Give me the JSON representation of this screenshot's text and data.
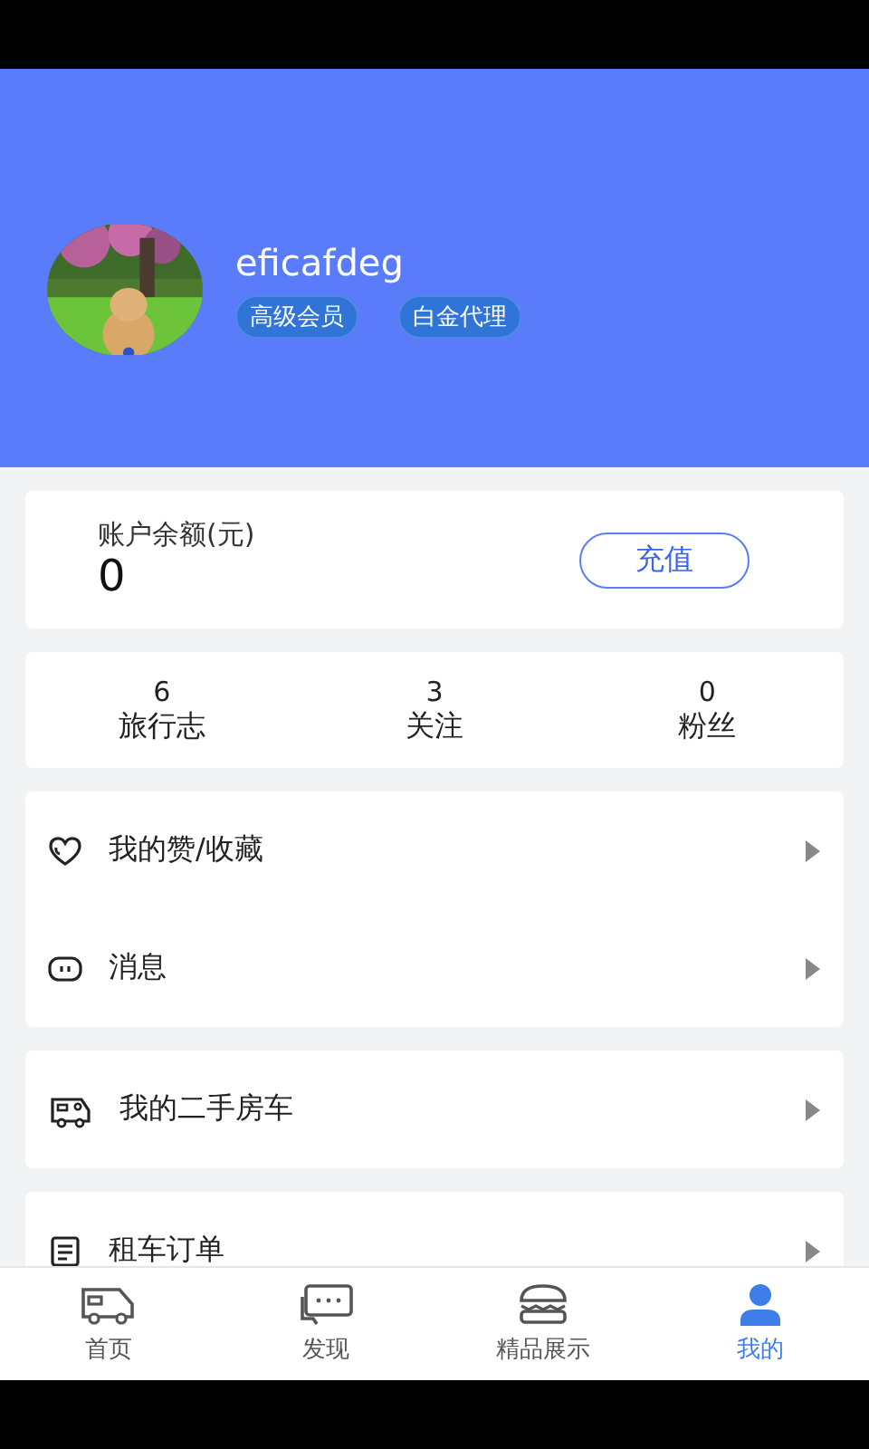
{
  "profile": {
    "username": "eficafdeg",
    "badges": [
      "高级会员",
      "白金代理"
    ]
  },
  "balance": {
    "label": "账户余额(元)",
    "amount": "0",
    "button": "充值"
  },
  "stats": [
    {
      "value": "6",
      "label": "旅行志"
    },
    {
      "value": "3",
      "label": "关注"
    },
    {
      "value": "0",
      "label": "粉丝"
    }
  ],
  "menu_groups": [
    [
      {
        "kind": "heart",
        "label": "我的赞/收藏"
      },
      {
        "kind": "message",
        "label": "消息"
      }
    ],
    [
      {
        "kind": "rv",
        "label": "我的二手房车"
      }
    ],
    [
      {
        "kind": "list",
        "label": "租车订单"
      }
    ]
  ],
  "tabs": [
    {
      "kind": "rv",
      "label": "首页",
      "selected": false
    },
    {
      "kind": "chat",
      "label": "发现",
      "selected": false
    },
    {
      "kind": "burger",
      "label": "精品展示",
      "selected": false
    },
    {
      "kind": "user",
      "label": "我的",
      "selected": true
    }
  ]
}
